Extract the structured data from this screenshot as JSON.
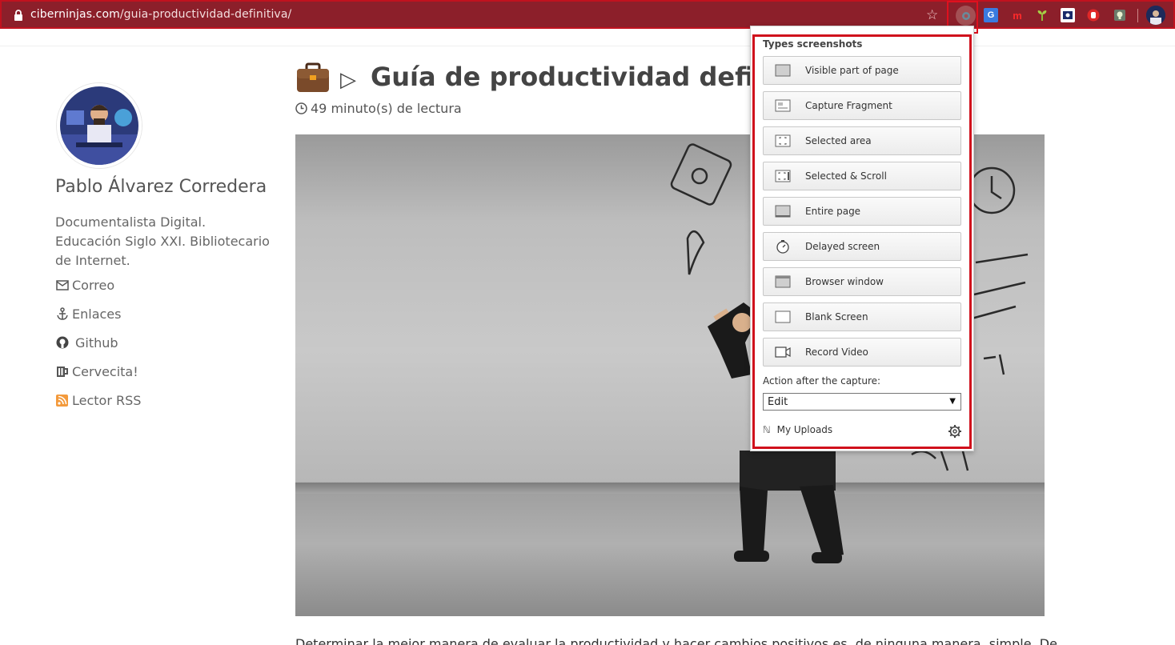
{
  "browser": {
    "url_domain": "ciberninjas.com",
    "url_path": "/guia-productividad-definitiva/"
  },
  "sidebar": {
    "author": "Pablo Álvarez Corredera",
    "bio": "Documentalista Digital. Educación Siglo XXI. Bibliotecario de Internet.",
    "links": [
      {
        "label": "Correo",
        "icon": "envelope-icon"
      },
      {
        "label": "Enlaces",
        "icon": "anchor-icon"
      },
      {
        "label": "Github",
        "icon": "github-icon"
      },
      {
        "label": "Cervecita!",
        "icon": "beer-icon"
      },
      {
        "label": "Lector RSS",
        "icon": "rss-icon"
      }
    ]
  },
  "article": {
    "title_prefix": "▷",
    "title": "Guía de productividad definitiva",
    "read_time": "49 minuto(s) de lectura",
    "body_start": "Determinar la mejor manera de evaluar la productividad y hacer cambios positivos es, de ninguna manera, simple. De"
  },
  "popup": {
    "heading": "Types screenshots",
    "buttons": [
      {
        "label": "Visible part of page",
        "icon": "visible-page-icon"
      },
      {
        "label": "Capture Fragment",
        "icon": "fragment-icon"
      },
      {
        "label": "Selected area",
        "icon": "selected-area-icon"
      },
      {
        "label": "Selected & Scroll",
        "icon": "selected-scroll-icon"
      },
      {
        "label": "Entire page",
        "icon": "entire-page-icon"
      },
      {
        "label": "Delayed screen",
        "icon": "timer-icon"
      },
      {
        "label": "Browser window",
        "icon": "browser-window-icon"
      },
      {
        "label": "Blank Screen",
        "icon": "blank-screen-icon"
      },
      {
        "label": "Record Video",
        "icon": "video-camera-icon"
      }
    ],
    "after_capture_label": "Action after the capture:",
    "after_capture_value": "Edit",
    "uploads_label": "My Uploads"
  },
  "colors": {
    "browser_bar": "#8c1f2a",
    "highlight_red": "#d0101c"
  }
}
